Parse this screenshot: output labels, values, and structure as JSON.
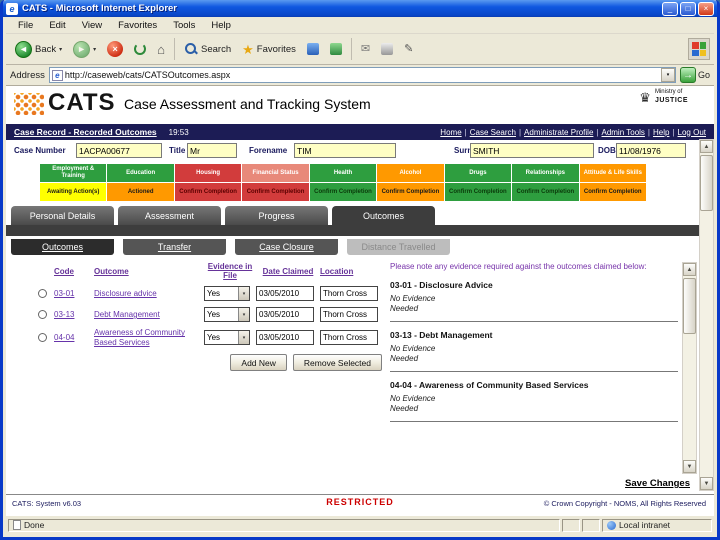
{
  "window": {
    "title": "CATS - Microsoft Internet Explorer",
    "menus": [
      "File",
      "Edit",
      "View",
      "Favorites",
      "Tools",
      "Help"
    ],
    "toolbar": {
      "back_label": "Back",
      "search_label": "Search",
      "favorites_label": "Favorites"
    },
    "address": {
      "label": "Address",
      "url": "http://caseweb/cats/CATSOutcomes.aspx",
      "go_label": "Go"
    },
    "status": {
      "left": "Done",
      "zone": "Local intranet"
    }
  },
  "header": {
    "logo_text": "CATS",
    "app_title": "Case Assessment and Tracking System",
    "moj_line1": "Ministry of",
    "moj_line2": "JUSTICE"
  },
  "navbar": {
    "title": "Case Record - Recorded Outcomes",
    "time": "19:53",
    "separator": "|",
    "links": [
      "Home",
      "Case Search",
      "Administrate Profile",
      "Admin Tools",
      "Help",
      "Log Out"
    ]
  },
  "case_form": {
    "case_number_label": "Case Number",
    "case_number": "1ACPA00677",
    "title_label": "Title",
    "title": "Mr",
    "forename_label": "Forename",
    "forename": "TIM",
    "surname_label": "Surname",
    "surname": "SMITH",
    "dob_label": "DOB",
    "dob": "11/08/1976"
  },
  "pathway_grid": {
    "columns": [
      {
        "name": "Employment & Training",
        "name_bg": "#2e9e3f",
        "name_fg": "#ffffff",
        "status": "Awaiting Action(s)",
        "status_bg": "#ffff00",
        "status_fg": "#1a1a1a"
      },
      {
        "name": "Education",
        "name_bg": "#2e9e3f",
        "name_fg": "#ffffff",
        "status": "Actioned",
        "status_bg": "#ff9900",
        "status_fg": "#1a1a1a"
      },
      {
        "name": "Housing",
        "name_bg": "#d23c3c",
        "name_fg": "#ffffff",
        "status": "Confirm Completion",
        "status_bg": "#d23c3c",
        "status_fg": "#5a0000"
      },
      {
        "name": "Financial Status",
        "name_bg": "#e8897a",
        "name_fg": "#ffffff",
        "status": "Confirm Completion",
        "status_bg": "#d23c3c",
        "status_fg": "#5a0000"
      },
      {
        "name": "Health",
        "name_bg": "#2e9e3f",
        "name_fg": "#ffffff",
        "status": "Confirm Completion",
        "status_bg": "#2e9e3f",
        "status_fg": "#0a3a0a"
      },
      {
        "name": "Alcohol",
        "name_bg": "#ff9900",
        "name_fg": "#ffffff",
        "status": "Confirm Completion",
        "status_bg": "#ff9900",
        "status_fg": "#1a1a1a"
      },
      {
        "name": "Drugs",
        "name_bg": "#2e9e3f",
        "name_fg": "#ffffff",
        "status": "Confirm Completion",
        "status_bg": "#2e9e3f",
        "status_fg": "#0a3a0a"
      },
      {
        "name": "Relationships",
        "name_bg": "#2e9e3f",
        "name_fg": "#ffffff",
        "status": "Confirm Completion",
        "status_bg": "#2e9e3f",
        "status_fg": "#0a3a0a"
      },
      {
        "name": "Attitude & Life Skills",
        "name_bg": "#ff9900",
        "name_fg": "#ffffff",
        "status": "Confirm Completion",
        "status_bg": "#ff9900",
        "status_fg": "#1a1a1a"
      }
    ]
  },
  "tabs": {
    "main": [
      "Personal Details",
      "Assessment",
      "Progress",
      "Outcomes"
    ],
    "sub": [
      "Outcomes",
      "Transfer",
      "Case Closure",
      "Distance Travelled"
    ]
  },
  "outcomes_table": {
    "headers": {
      "code": "Code",
      "outcome": "Outcome",
      "evidence": "Evidence in File",
      "date": "Date Claimed",
      "location": "Location"
    },
    "rows": [
      {
        "code": "03-01",
        "outcome": "Disclosure advice",
        "evidence": "Yes",
        "date": "03/05/2010",
        "location": "Thorn Cross"
      },
      {
        "code": "03-13",
        "outcome": "Debt Management",
        "evidence": "Yes",
        "date": "03/05/2010",
        "location": "Thorn Cross"
      },
      {
        "code": "04-04",
        "outcome": "Awareness of Community Based Services",
        "evidence": "Yes",
        "date": "03/05/2010",
        "location": "Thorn Cross"
      }
    ],
    "buttons": {
      "add": "Add New",
      "remove": "Remove Selected"
    }
  },
  "evidence_panel": {
    "intro": "Please note any evidence required against the outcomes claimed below:",
    "entries": [
      {
        "title": "03-01 - Disclosure Advice",
        "note": "No Evidence Needed"
      },
      {
        "title": "03-13 - Debt Management",
        "note": "No Evidence Needed"
      },
      {
        "title": "04-04 - Awareness of Community Based Services",
        "note": "No Evidence Needed"
      }
    ]
  },
  "footer": {
    "save_label": "Save Changes",
    "version": "CATS: System v6.03",
    "classification": "RESTRICTED",
    "copyright": "© Crown Copyright - NOMS, All Rights Reserved"
  },
  "icons": {
    "back_arrow": "◄",
    "forward_arrow": "►",
    "stop": "×",
    "home": "⌂",
    "mail": "✉",
    "edit_pencil": "✎",
    "dropdown": "▾",
    "scroll_up": "▲",
    "scroll_down": "▼",
    "go_arrow": "→",
    "minimize": "_",
    "maximize": "□",
    "close": "×",
    "ie_e": "e",
    "moj_crest": "♛"
  }
}
